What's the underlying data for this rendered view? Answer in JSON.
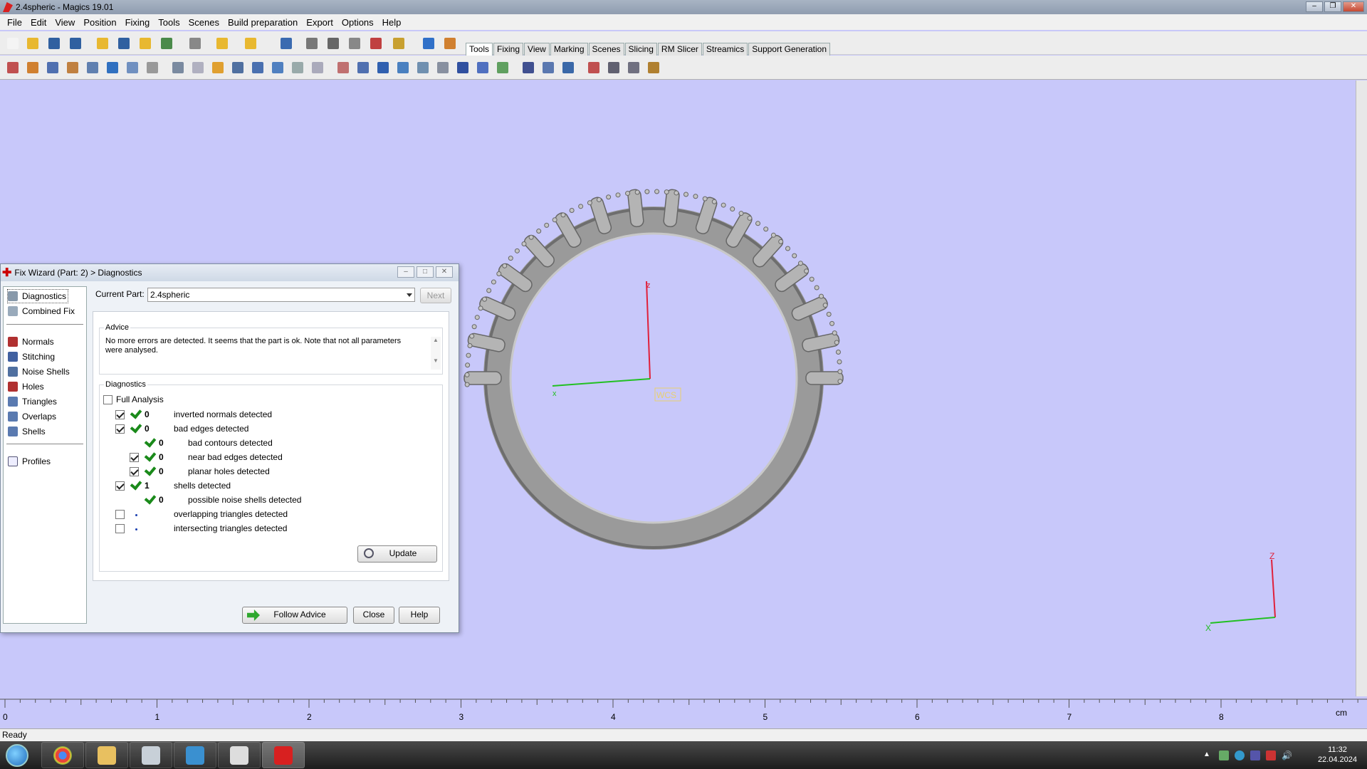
{
  "window": {
    "title": "2.4spheric - Magics 19.01"
  },
  "menu": [
    "File",
    "Edit",
    "View",
    "Position",
    "Fixing",
    "Tools",
    "Scenes",
    "Build preparation",
    "Export",
    "Options",
    "Help"
  ],
  "tabs": [
    "Tools",
    "Fixing",
    "View",
    "Marking",
    "Scenes",
    "Slicing",
    "RM Slicer",
    "Streamics",
    "Support Generation"
  ],
  "viewport": {
    "wcs_label": "WCS",
    "axis_x": "x",
    "axis_z": "z",
    "mini_axis_x": "X",
    "mini_axis_z": "Z"
  },
  "ruler": {
    "ticks": [
      "0",
      "1",
      "2",
      "3",
      "4",
      "5",
      "6",
      "7",
      "8"
    ],
    "unit": "cm"
  },
  "status": "Ready",
  "dialog": {
    "title": "Fix Wizard (Part: 2) > Diagnostics",
    "nav": {
      "top": [
        "Diagnostics",
        "Combined Fix"
      ],
      "middle": [
        "Normals",
        "Stitching",
        "Noise Shells",
        "Holes",
        "Triangles",
        "Overlaps",
        "Shells"
      ],
      "bottom": [
        "Profiles"
      ]
    },
    "current_part_label": "Current Part:",
    "current_part_value": "2.4spheric",
    "next_label": "Next",
    "advice_label": "Advice",
    "advice_text": "No more errors are detected. It seems that the part is ok. Note that not all parameters were analysed.",
    "diagnostics_label": "Diagnostics",
    "full_analysis_label": "Full Analysis",
    "rows": [
      {
        "checked": true,
        "indent": 0,
        "status": "ok",
        "count": "0",
        "text": "inverted normals detected"
      },
      {
        "checked": true,
        "indent": 0,
        "status": "ok",
        "count": "0",
        "text": "bad edges detected"
      },
      {
        "checked": null,
        "indent": 1,
        "status": "ok",
        "count": "0",
        "text": "bad contours detected"
      },
      {
        "checked": true,
        "indent": 1,
        "status": "ok",
        "count": "0",
        "text": "near bad edges detected"
      },
      {
        "checked": true,
        "indent": 1,
        "status": "ok",
        "count": "0",
        "text": "planar holes detected"
      },
      {
        "checked": true,
        "indent": 0,
        "status": "ok",
        "count": "1",
        "text": "shells detected"
      },
      {
        "checked": null,
        "indent": 1,
        "status": "ok",
        "count": "0",
        "text": "possible noise shells detected"
      },
      {
        "checked": false,
        "indent": 0,
        "status": "none",
        "count": "",
        "text": "overlapping triangles detected"
      },
      {
        "checked": false,
        "indent": 0,
        "status": "none",
        "count": "",
        "text": "intersecting triangles detected"
      }
    ],
    "update_label": "Update",
    "follow_advice_label": "Follow Advice",
    "close_label": "Close",
    "help_label": "Help"
  },
  "taskbar": {
    "time": "11:32",
    "date": "22.04.2024"
  },
  "colors": {
    "viewport": "#c8c8fa",
    "ok_tick": "#1a8a1a",
    "axis_x": "#22c022",
    "axis_z": "#e0203a",
    "ring": "#a8a8a8"
  }
}
